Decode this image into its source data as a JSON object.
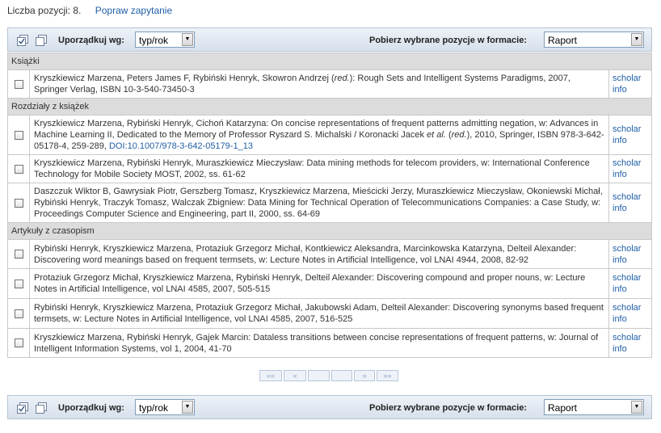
{
  "summary": {
    "count_label": "Liczba pozycji: 8.",
    "refine_link": "Popraw zapytanie"
  },
  "toolbar": {
    "sort_label": "Uporządkuj wg:",
    "sort_value": "typ/rok",
    "format_label": "Pobierz wybrane pozycje w formacie:",
    "format_value": "Raport"
  },
  "sections": [
    {
      "title": "Książki"
    },
    {
      "title": "Rozdziały z książek"
    },
    {
      "title": "Artykuły z czasopism"
    }
  ],
  "items": [
    {
      "pre": "Kryszkiewicz Marzena, Peters James F, Rybiński Henryk, Skowron Andrzej (",
      "red": "red.",
      "post": "): Rough Sets and Intelligent Systems Paradigms, 2007, Springer Verlag, ISBN 10-3-540-73450-3",
      "doi": "",
      "scholar": "scholar",
      "info": "info"
    },
    {
      "pre": "Kryszkiewicz Marzena, Rybiński Henryk, Cichoń Katarzyna: On concise representations of frequent patterns admitting negation, w: Advances in Machine Learning II, Dedicated to the Memory of Professor Ryszard S. Michalski / Koronacki Jacek ",
      "etal": "et al.",
      "mid": " (",
      "red": "red.",
      "post": "), 2010, Springer, ISBN 978-3-642-05178-4, 259-289, ",
      "doi": "DOI:10.1007/978-3-642-05179-1_13",
      "scholar": "scholar",
      "info": "info"
    },
    {
      "pre": "Kryszkiewicz Marzena, Rybiński Henryk, Muraszkiewicz Mieczysław: Data mining methods for telecom providers, w: International Conference Technology for Mobile Society MOST, 2002, ss. 61-62",
      "doi": "",
      "scholar": "scholar",
      "info": "info"
    },
    {
      "pre": "Daszczuk Wiktor B, Gawrysiak Piotr, Gerszberg Tomasz, Kryszkiewicz Marzena, Mieścicki Jerzy, Muraszkiewicz Mieczysław, Okoniewski Michał, Rybiński Henryk, Traczyk Tomasz, Walczak Zbigniew: Data Mining for Technical Operation of Telecommunications Companies: a Case Study, w: Proceedings Computer Science and Engineering, part II, 2000, ss. 64-69",
      "doi": "",
      "scholar": "scholar",
      "info": "info"
    },
    {
      "pre": "Rybiński Henryk, Kryszkiewicz Marzena, Protaziuk Grzegorz Michał, Kontkiewicz Aleksandra, Marcinkowska Katarzyna, Delteil Alexander: Discovering word meanings based on frequent termsets, w: Lecture Notes in Artificial Intelligence, vol LNAI 4944, 2008, 82-92",
      "doi": "",
      "scholar": "scholar",
      "info": "info"
    },
    {
      "pre": "Protaziuk Grzegorz Michał, Kryszkiewicz Marzena, Rybiński Henryk, Delteil Alexander: Discovering compound and proper nouns, w: Lecture Notes in Artificial Intelligence, vol LNAI 4585, 2007, 505-515",
      "doi": "",
      "scholar": "scholar",
      "info": "info"
    },
    {
      "pre": "Rybiński Henryk, Kryszkiewicz Marzena, Protaziuk Grzegorz Michał, Jakubowski Adam, Delteil Alexander: Discovering synonyms based frequent termsets, w: Lecture Notes in Artificial Intelligence, vol LNAI 4585, 2007, 516-525",
      "doi": "",
      "scholar": "scholar",
      "info": "info"
    },
    {
      "pre": "Kryszkiewicz Marzena, Rybiński Henryk, Gajek Marcin: Dataless transitions between concise representations of frequent patterns, w: Journal of Intelligent Information Systems, vol 1, 2004, 41-70",
      "doi": "",
      "scholar": "scholar",
      "info": "info"
    }
  ],
  "pager": {
    "first": "««",
    "prev": "«",
    "next": "»",
    "last": "»»"
  }
}
